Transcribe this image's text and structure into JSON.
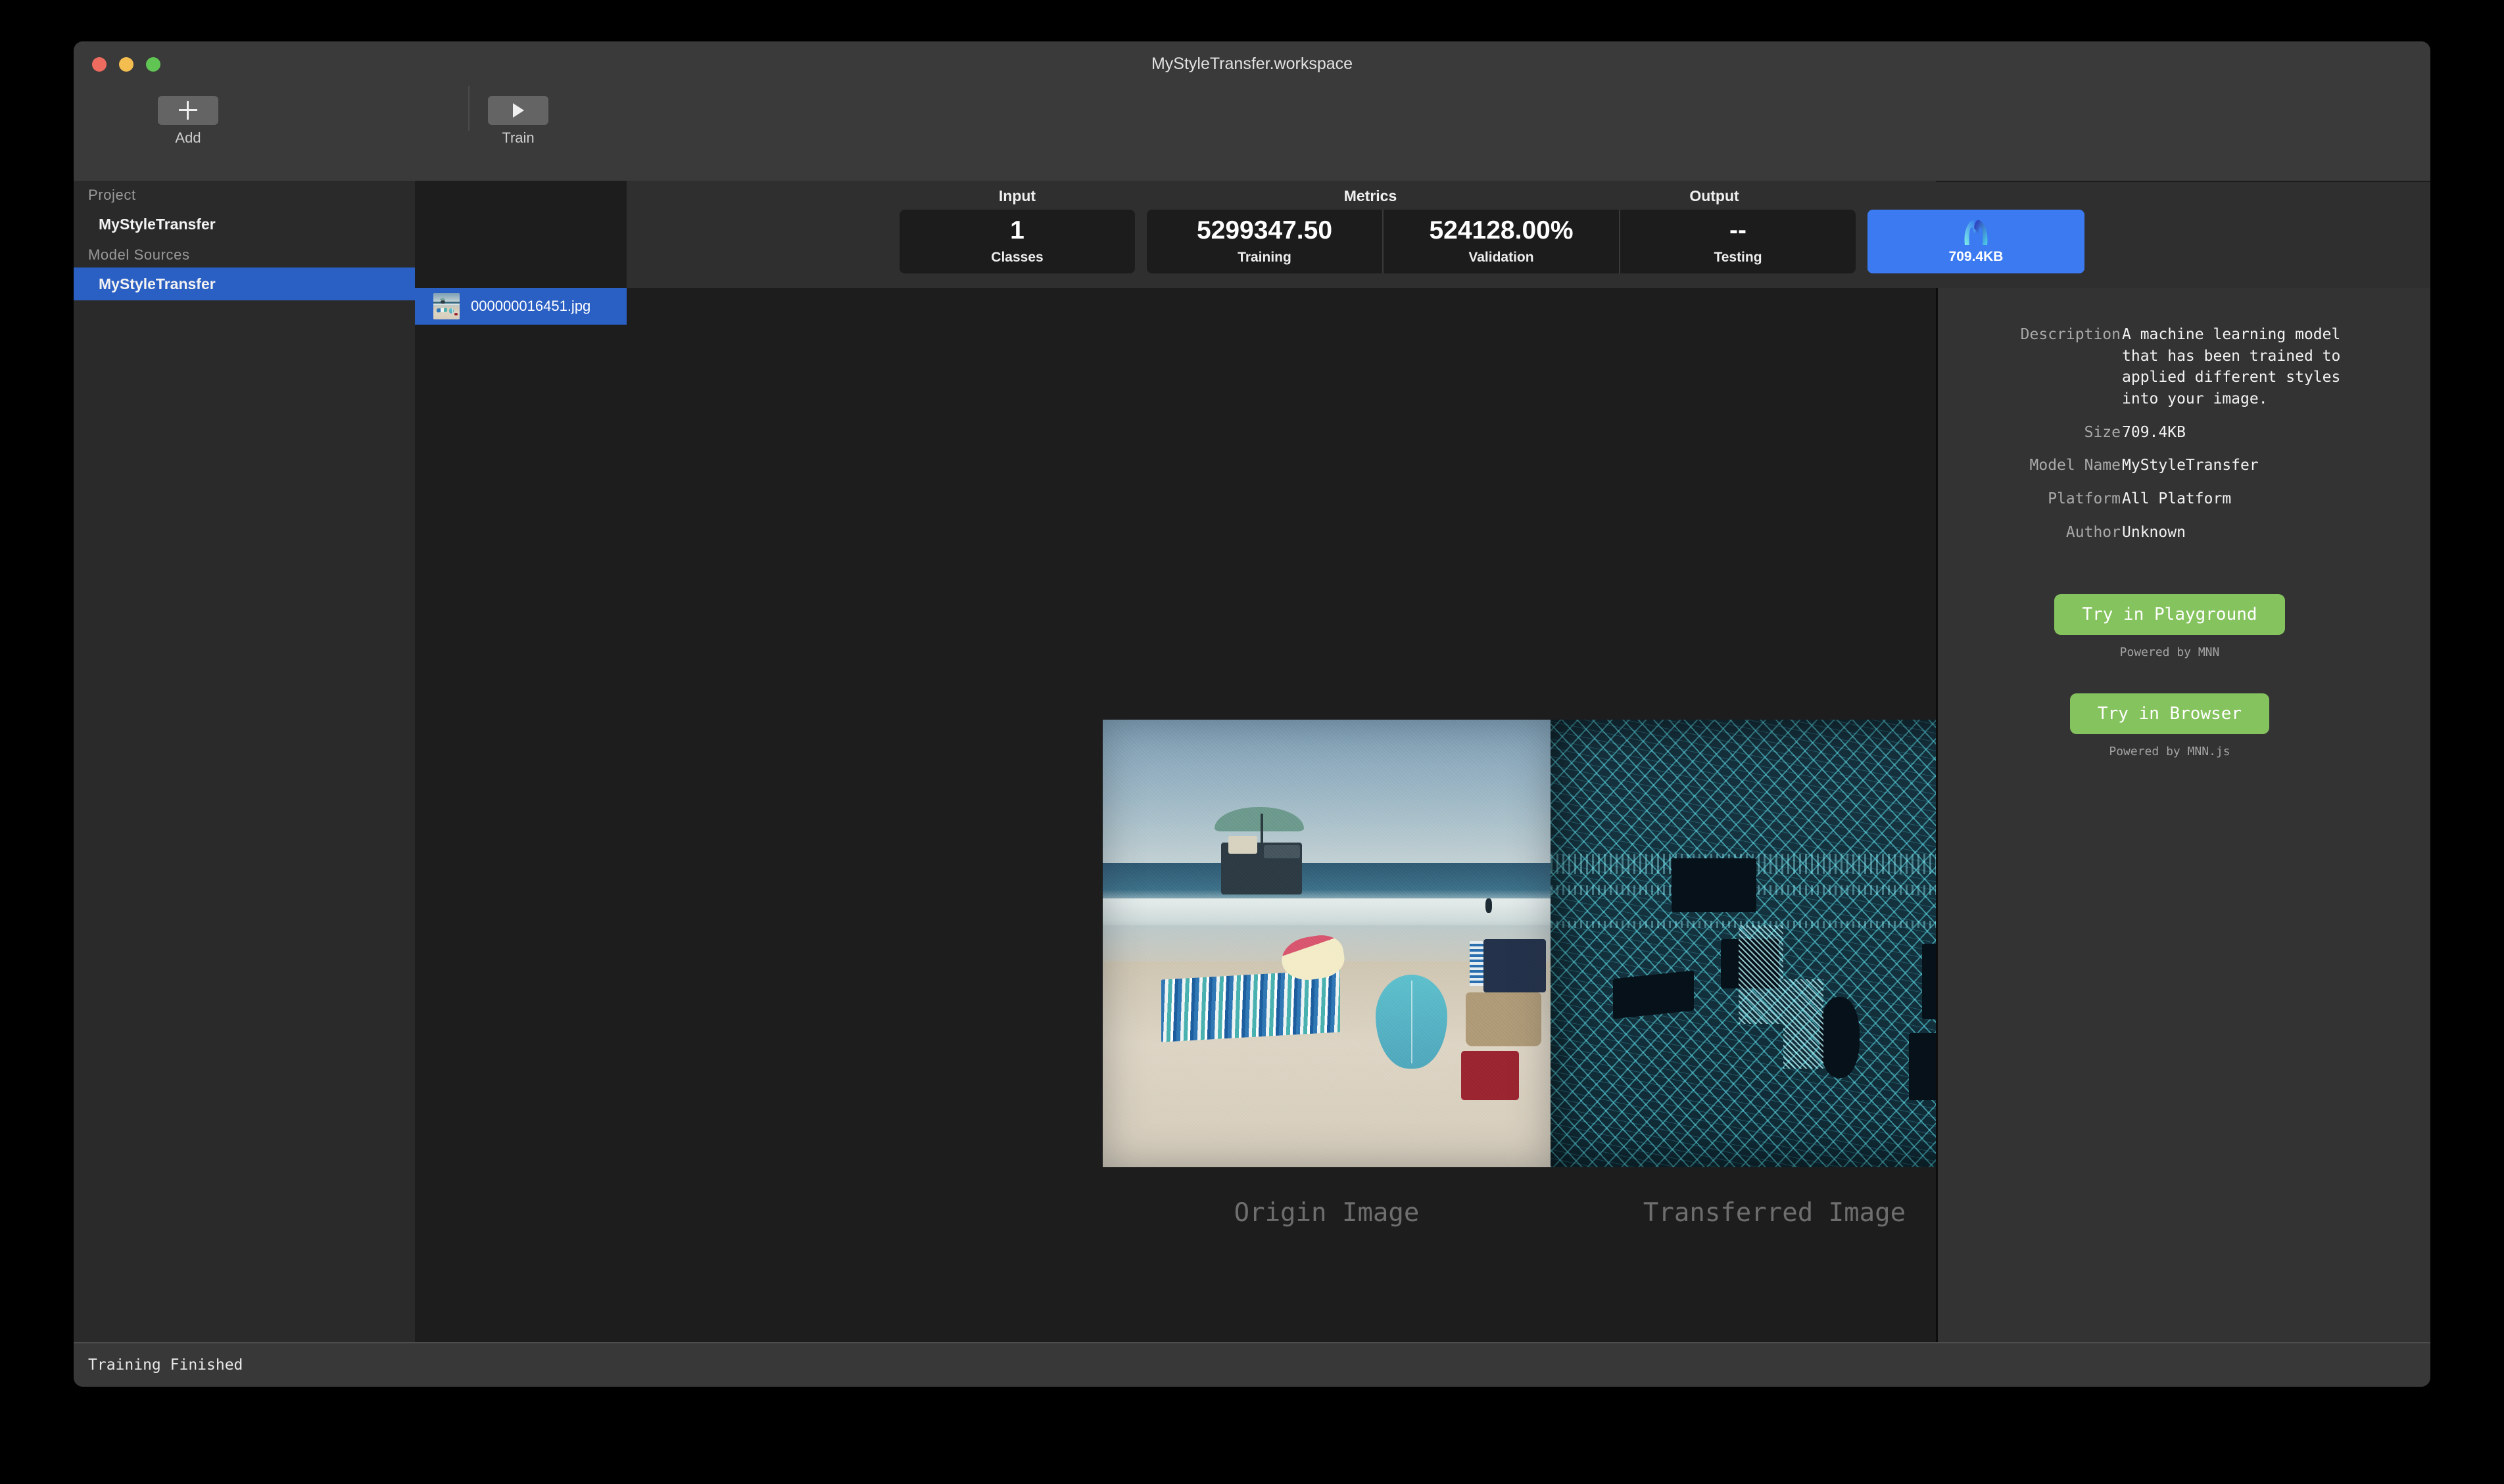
{
  "window": {
    "title": "MyStyleTransfer.workspace",
    "traffic_lights": [
      "close-red",
      "minimize-yellow",
      "zoom-green"
    ]
  },
  "toolbar": {
    "items": [
      {
        "label": "Add",
        "icon": "plus-icon"
      },
      {
        "label": "Train",
        "icon": "play-icon"
      }
    ]
  },
  "sidebar": {
    "sections": [
      {
        "header": "Project",
        "items": [
          {
            "label": "MyStyleTransfer",
            "selected": false
          }
        ]
      },
      {
        "header": "Model Sources",
        "items": [
          {
            "label": "MyStyleTransfer",
            "selected": true
          }
        ]
      }
    ]
  },
  "file_list": {
    "items": [
      {
        "name": "000000016451.jpg",
        "selected": true,
        "thumbnail": "beach-photo-thumbnail"
      }
    ]
  },
  "metrics_bar": {
    "groups": [
      {
        "label": "Input"
      },
      {
        "label": "Metrics"
      },
      {
        "label": "Output"
      }
    ],
    "cards": [
      {
        "value": "1",
        "name": "Classes"
      },
      {
        "value": "5299347.50",
        "name": "Training"
      },
      {
        "value": "524128.00%",
        "name": "Validation"
      },
      {
        "value": "--",
        "name": "Testing"
      }
    ],
    "output": {
      "size": "709.4KB",
      "icon": "mnn-logo-icon",
      "color": "#3b7af0"
    }
  },
  "canvas": {
    "images": [
      {
        "caption": "Origin Image",
        "name": "origin-image"
      },
      {
        "caption": "Transferred Image",
        "name": "transferred-image"
      }
    ]
  },
  "detail_panel": {
    "fields": [
      {
        "label": "Description",
        "value": "A machine learning model\nthat has been trained to\napplied different styles\ninto your image."
      },
      {
        "label": "Size",
        "value": "709.4KB"
      },
      {
        "label": "Model Name",
        "value": "MyStyleTransfer"
      },
      {
        "label": "Platform",
        "value": "All Platform"
      },
      {
        "label": "Author",
        "value": "Unknown"
      }
    ],
    "actions": [
      {
        "label": "Try in Playground",
        "note": "Powered by MNN",
        "color": "#85c35e"
      },
      {
        "label": "Try in Browser",
        "note": "Powered by MNN.js",
        "color": "#85c35e"
      }
    ]
  },
  "status_bar": {
    "text": "Training Finished"
  }
}
